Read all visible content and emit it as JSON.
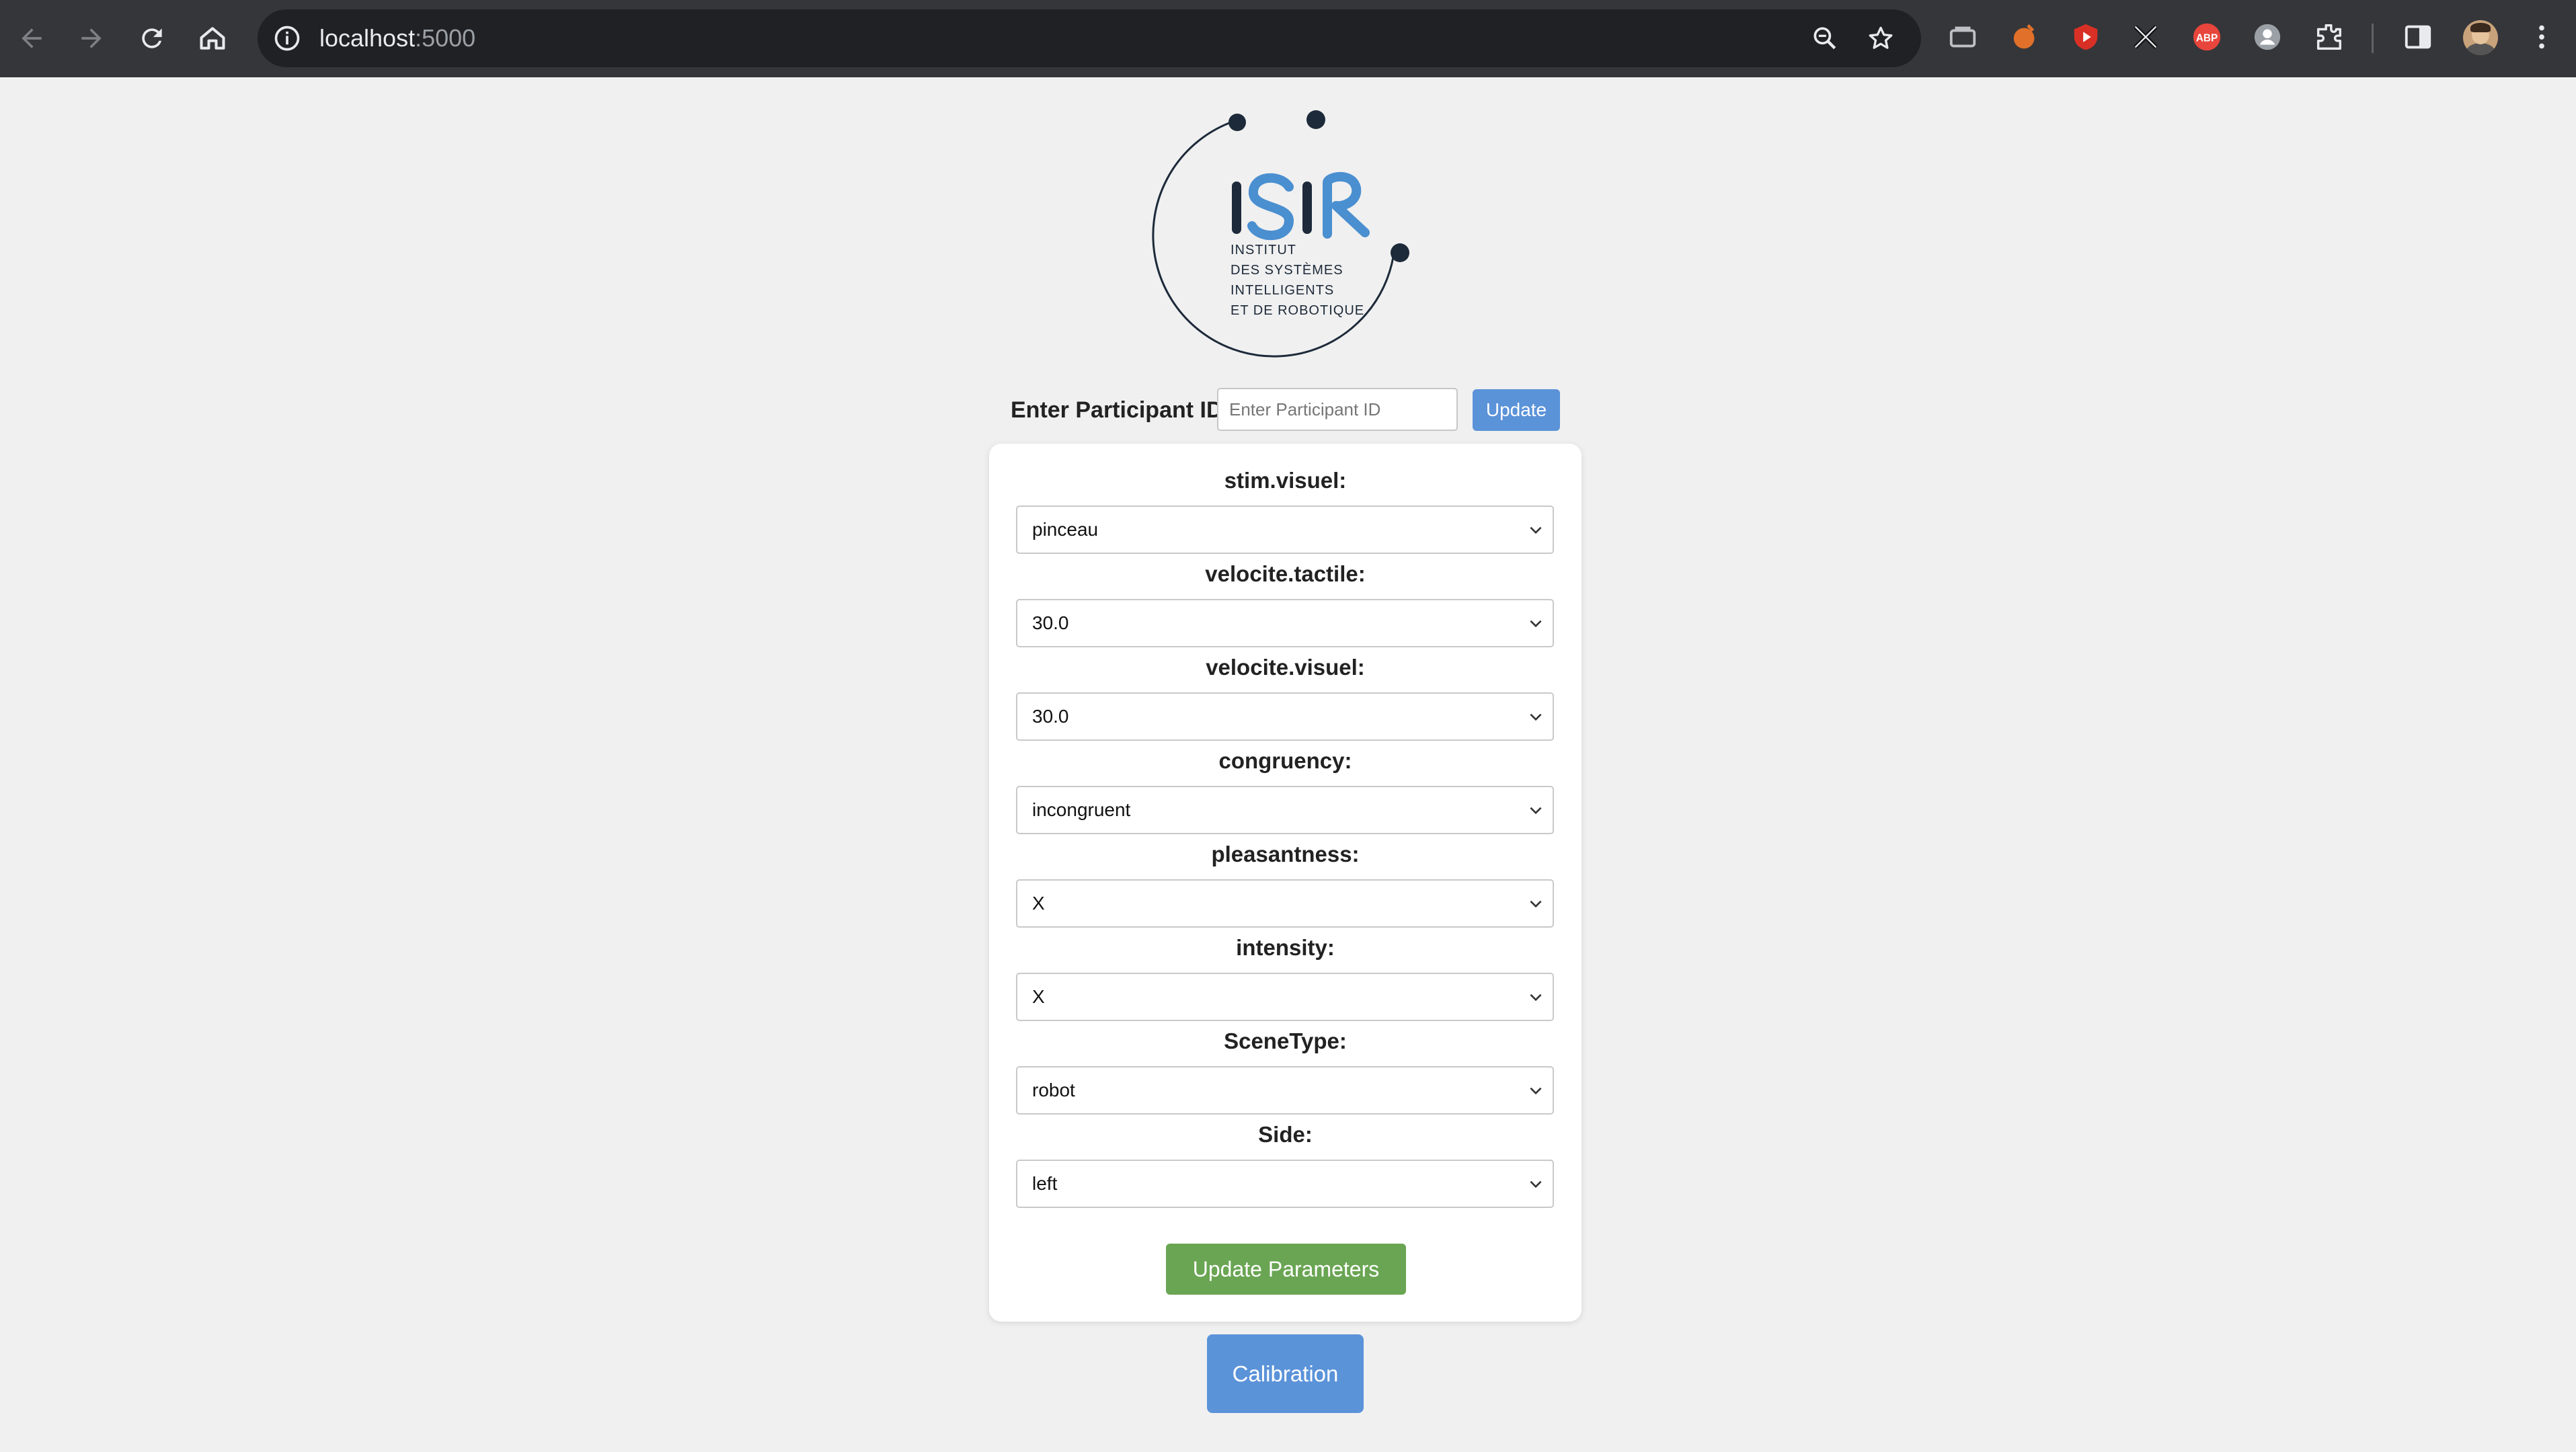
{
  "browser": {
    "url_host": "localhost",
    "url_port": ":5000",
    "icons": [
      "back-icon",
      "forward-icon",
      "reload-icon",
      "home-icon",
      "info-icon",
      "zoom-icon",
      "bookmark-star-icon",
      "extensions-icon",
      "side-panel-icon",
      "menu-icon"
    ]
  },
  "logo": {
    "brand_letters": "ISIR",
    "lines": [
      "INSTITUT",
      "DES SYSTÈMES",
      "INTELLIGENTS",
      "ET DE ROBOTIQUE"
    ],
    "colors": {
      "dark": "#1d2a3a",
      "blue": "#4a8fd0"
    }
  },
  "participant": {
    "label": "Enter Participant ID:",
    "placeholder": "Enter Participant ID",
    "value": "",
    "button_label": "Update"
  },
  "parameters": {
    "fields": [
      {
        "label": "stim.visuel:",
        "value": "pinceau"
      },
      {
        "label": "velocite.tactile:",
        "value": "30.0"
      },
      {
        "label": "velocite.visuel:",
        "value": "30.0"
      },
      {
        "label": "congruency:",
        "value": "incongruent"
      },
      {
        "label": "pleasantness:",
        "value": "X"
      },
      {
        "label": "intensity:",
        "value": "X"
      },
      {
        "label": "SceneType:",
        "value": "robot"
      },
      {
        "label": "Side:",
        "value": "left"
      }
    ],
    "submit_label": "Update Parameters"
  },
  "calibration": {
    "label": "Calibration"
  },
  "colors": {
    "page_bg": "#f0f0f0",
    "primary_blue": "#5b93d9",
    "green": "#6aa553",
    "chrome_bg": "#35363a"
  }
}
